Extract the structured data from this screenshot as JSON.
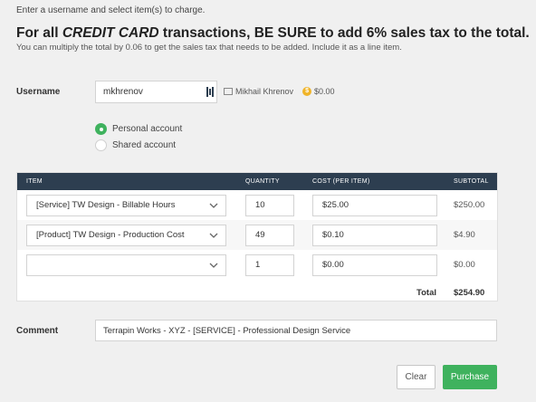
{
  "instructions": {
    "top_note": "Enter a username and select item(s) to charge.",
    "headline_pre": "For all ",
    "headline_em": "CREDIT CARD",
    "headline_post": " transactions, BE SURE to add 6% sales tax to the total.",
    "subnote": "You can multiply the total by 0.06 to get the sales tax that needs to be added. Include it as a line item."
  },
  "username": {
    "label": "Username",
    "value": "mkhrenov",
    "full_name": "Mikhail Khrenov",
    "balance": "$0.00"
  },
  "account": {
    "options": [
      {
        "label": "Personal account",
        "checked": true
      },
      {
        "label": "Shared account",
        "checked": false
      }
    ]
  },
  "table": {
    "headers": {
      "item": "ITEM",
      "quantity": "QUANTITY",
      "cost": "COST (PER ITEM)",
      "subtotal": "SUBTOTAL"
    },
    "rows": [
      {
        "item": "[Service] TW Design - Billable Hours",
        "quantity": "10",
        "cost": "$25.00",
        "subtotal": "$250.00"
      },
      {
        "item": "[Product] TW Design - Production Cost",
        "quantity": "49",
        "cost": "$0.10",
        "subtotal": "$4.90"
      },
      {
        "item": "",
        "quantity": "1",
        "cost": "$0.00",
        "subtotal": "$0.00"
      }
    ],
    "total_label": "Total",
    "total_value": "$254.90"
  },
  "comment": {
    "label": "Comment",
    "value": "Terrapin Works - XYZ - [SERVICE] - Professional Design Service"
  },
  "buttons": {
    "clear": "Clear",
    "purchase": "Purchase"
  },
  "colors": {
    "accent_green": "#3fb25e",
    "table_header": "#2d3e50",
    "coin": "#f0b429"
  },
  "icons": {
    "id_card": "id-card-icon",
    "user_card": "user-card-icon",
    "coin": "dollar-coin-icon",
    "chevron": "chevron-down-icon"
  }
}
